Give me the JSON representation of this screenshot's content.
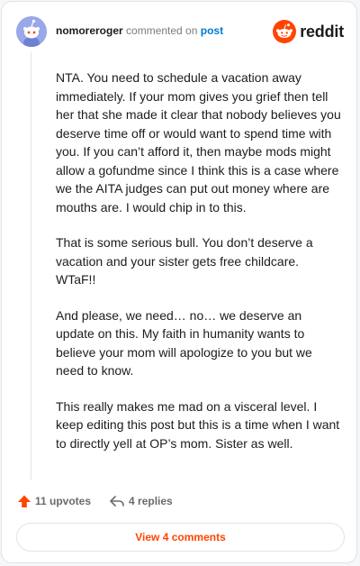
{
  "header": {
    "username": "nomoreroger",
    "action_text": "commented on",
    "post_link": "post",
    "brand": "reddit"
  },
  "comment": {
    "paragraphs": [
      "NTA. You need to schedule a vacation away immediately. If your mom gives you grief then tell her that she made it clear that nobody believes you deserve time off or would want to spend time with you. If you can’t afford it, then maybe mods might allow a gofundme since I think this is a case where we the AITA judges can put out money where are mouths are. I would chip in to this.",
      "That is some serious bull. You don’t deserve a vacation and your sister gets free childcare. WTaF!!",
      "And please, we need… no… we deserve an update on this. My faith in humanity wants to believe your mom will apologize to you but we need to know.",
      "This really makes me mad on a visceral level. I keep editing this post but this is a time when I want to directly yell at OP’s mom. Sister as well."
    ]
  },
  "footer": {
    "upvotes": "11 upvotes",
    "replies": "4 replies",
    "view_comments": "View 4 comments"
  },
  "icons": {
    "avatar": "snoo-avatar-icon",
    "logo": "reddit-logo-icon",
    "upvote": "upvote-arrow-icon",
    "reply": "reply-arrow-icon"
  },
  "colors": {
    "accent": "#ff4500",
    "link": "#0079d3",
    "avatar_bg": "#9aa8e8"
  }
}
